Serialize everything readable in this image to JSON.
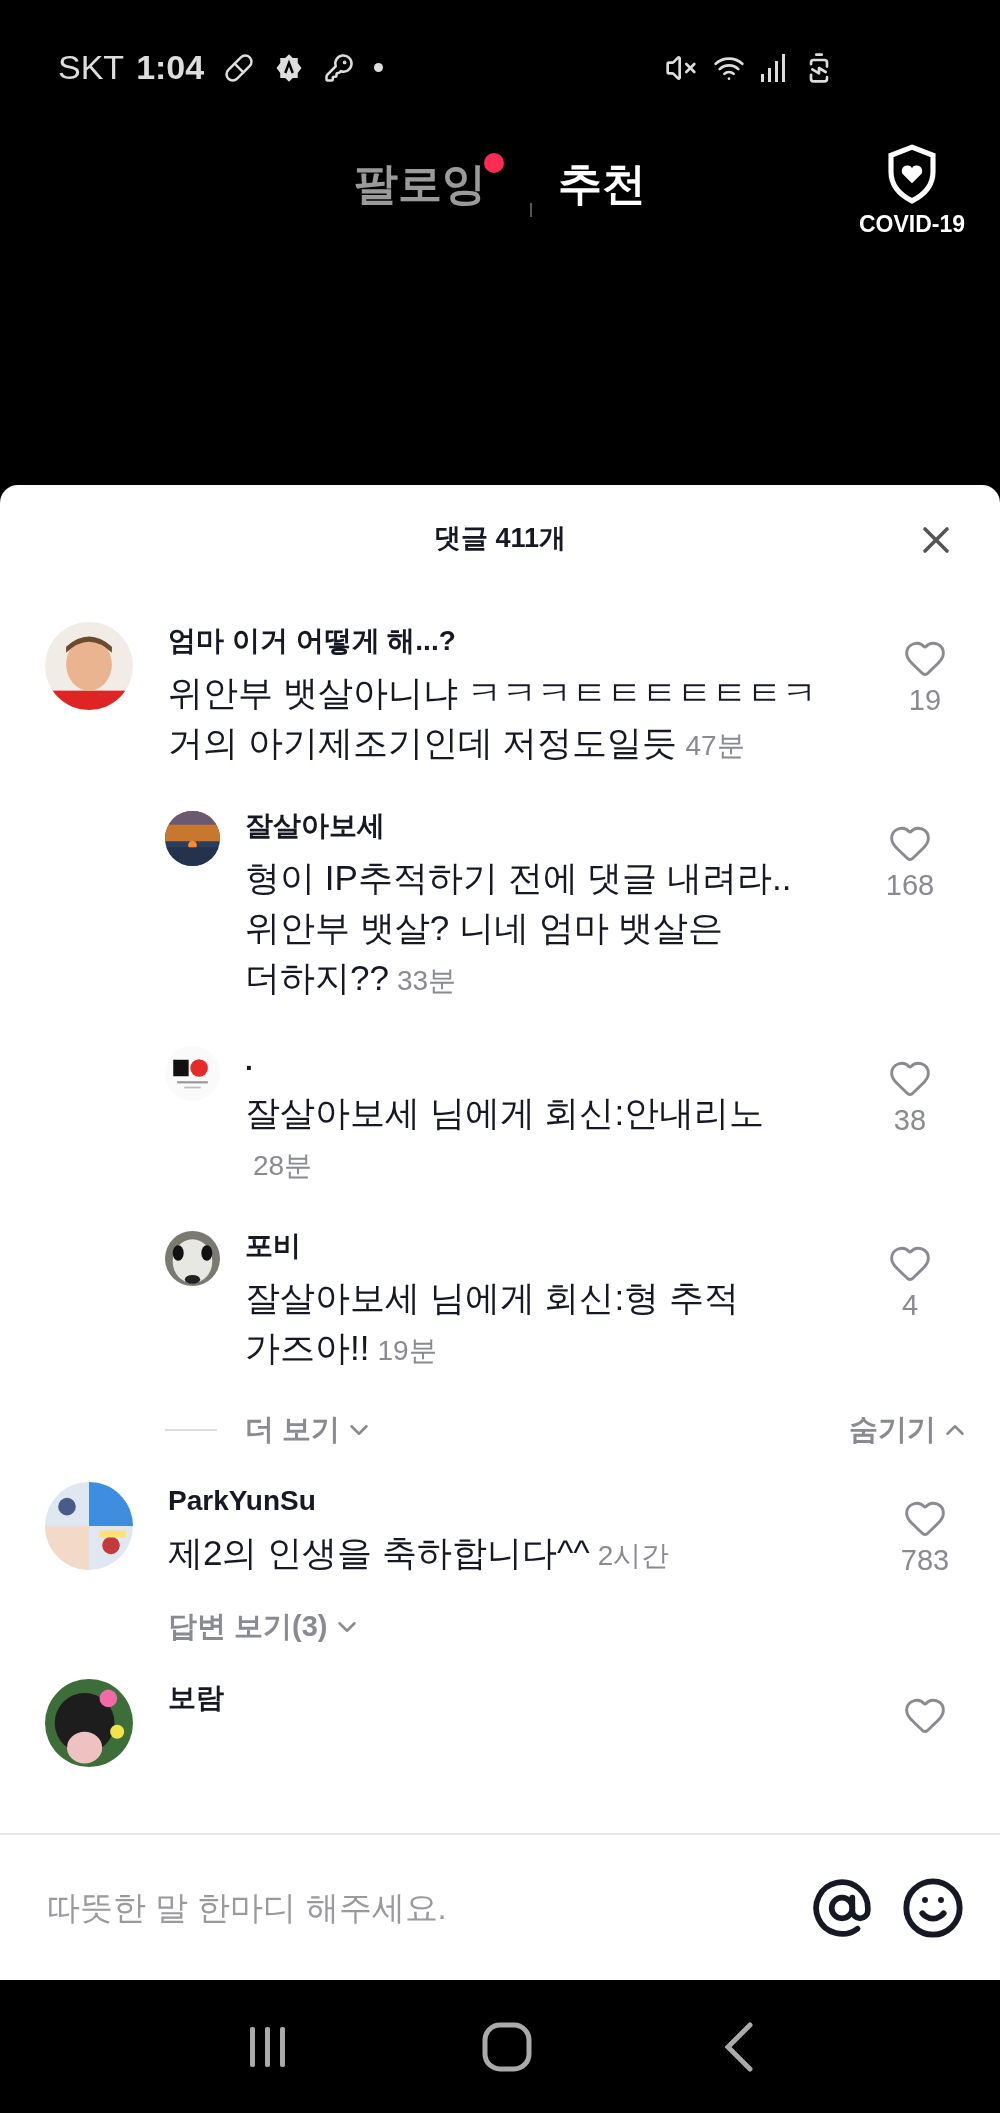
{
  "status_bar": {
    "carrier": "SKT",
    "time": "1:04"
  },
  "top_tabs": [
    {
      "label": "팔로잉",
      "selected": false,
      "notification_dot": true
    },
    {
      "label": "추천",
      "selected": true,
      "notification_dot": false
    }
  ],
  "covid_button": {
    "label": "COVID-19"
  },
  "comments_sheet": {
    "title": "댓글 411개",
    "comments": [
      {
        "username": "엄마 이거 어떻게 해...?",
        "text": "위안부 뱃살아니냐 ㅋㅋㅋㅌㅌㅌㅌㅌㅌㅋ 거의 아기제조기인데 저정도일듯",
        "time": "47분",
        "likes": "19",
        "replies": [
          {
            "username": "잘살아보세",
            "text": "형이 IP추적하기 전에 댓글 내려라.. 위안부 뱃살? 니네 엄마 뱃살은 더하지??",
            "time": "33분",
            "likes": "168"
          },
          {
            "username": ".",
            "text": "잘살아보세 님에게 회신:안내리노",
            "time": "28분",
            "likes": "38"
          },
          {
            "username": "포비",
            "text": "잘살아보세 님에게 회신:형 추적 가즈아!!",
            "time": "19분",
            "likes": "4"
          }
        ],
        "more_replies": "더 보기",
        "hide_replies": "숨기기"
      },
      {
        "username": "ParkYunSu",
        "text": "제2의 인생을 축하합니다^^",
        "time": "2시간",
        "likes": "783",
        "view_replies": "답변 보기(3)"
      },
      {
        "username": "보람"
      }
    ]
  },
  "comment_input": {
    "placeholder": "따뜻한 말 한마디 해주세요."
  }
}
